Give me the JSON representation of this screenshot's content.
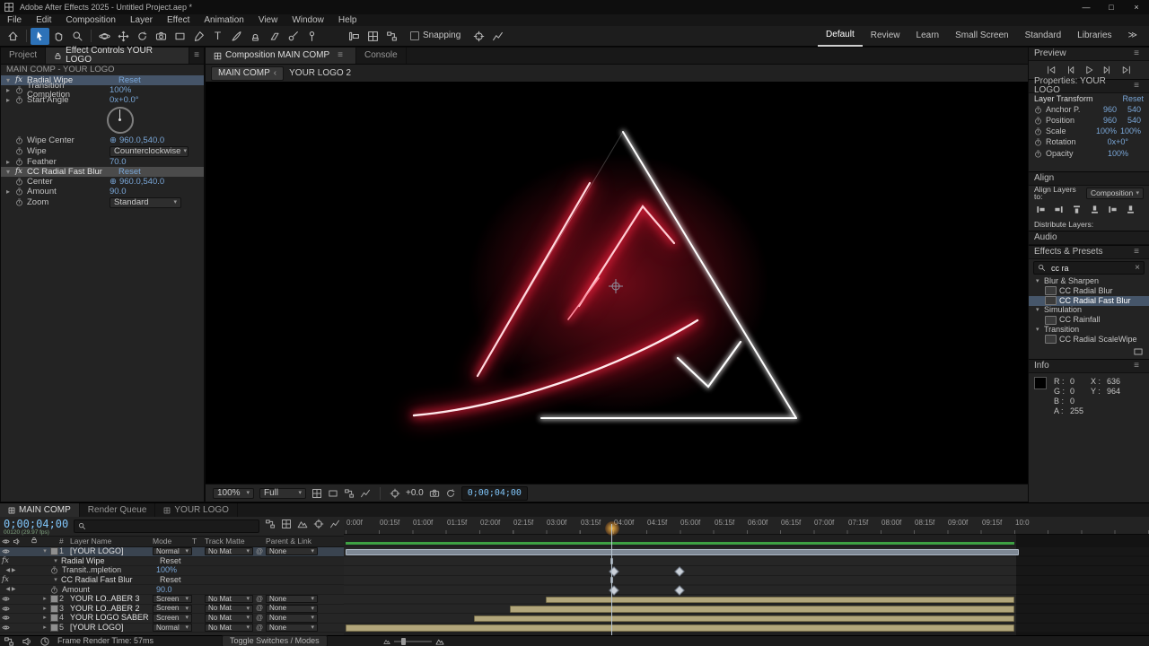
{
  "icons": {
    "minimize": "—",
    "maximize": "□",
    "close": "×",
    "menu": "≡",
    "chevron_down": "▾",
    "chevron_right": "▸",
    "overflow": "≫",
    "crosshair": "⊕",
    "pickwhip": "@",
    "back": "‹",
    "fx": "fx",
    "kf_prev": "◀",
    "kf_next": "▶",
    "clear": "×",
    "hash": "#"
  },
  "titlebar": {
    "title": "Adobe After Effects 2025 - Untitled Project.aep *"
  },
  "menubar": {
    "items": [
      "File",
      "Edit",
      "Composition",
      "Layer",
      "Effect",
      "Animation",
      "View",
      "Window",
      "Help"
    ]
  },
  "toolbar": {
    "snapping": "Snapping",
    "workspaces": [
      "Default",
      "Review",
      "Learn",
      "Small Screen",
      "Standard",
      "Libraries"
    ]
  },
  "effect_controls": {
    "tab_project": "Project",
    "tab_active": "Effect Controls YOUR LOGO",
    "comp": "MAIN COMP - YOUR LOGO",
    "groups": [
      {
        "name": "Radial Wipe",
        "reset": "Reset"
      },
      {
        "name": "CC Radial Fast Blur",
        "reset": "Reset"
      }
    ],
    "props": [
      {
        "label": "Transition Completion",
        "value": "100%"
      },
      {
        "label": "Start Angle",
        "value": "0x+0.0°"
      },
      {
        "label": "Wipe Center",
        "value": "960.0,540.0"
      },
      {
        "label": "Wipe",
        "value": "Counterclockwise"
      },
      {
        "label": "Feather",
        "value": "70.0"
      },
      {
        "label": "Center",
        "value": "960.0,540.0"
      },
      {
        "label": "Amount",
        "value": "90.0"
      },
      {
        "label": "Zoom",
        "value": "Standard"
      }
    ]
  },
  "viewer": {
    "tab_active": "Composition MAIN COMP",
    "tab_console": "Console",
    "breadcrumb_comp": "MAIN COMP",
    "breadcrumb_layer": "YOUR LOGO 2",
    "zoom": "100%",
    "resolution": "Full",
    "exposure": "+0.0",
    "timecode": "0;00;04;00"
  },
  "preview": {
    "title": "Preview"
  },
  "properties": {
    "title": "Properties: YOUR LOGO",
    "section": "Layer Transform",
    "reset": "Reset",
    "rows": [
      {
        "label": "Anchor P.",
        "v1": "960",
        "v2": "540"
      },
      {
        "label": "Position",
        "v1": "960",
        "v2": "540"
      },
      {
        "label": "Scale",
        "v1": "100%",
        "v2": "100%"
      },
      {
        "label": "Rotation",
        "v1": "0x+0°",
        "v2": ""
      },
      {
        "label": "Opacity",
        "v1": "100%",
        "v2": ""
      }
    ]
  },
  "align": {
    "title": "Align",
    "align_to_label": "Align Layers to:",
    "align_to": "Composition",
    "distribute_label": "Distribute Layers:"
  },
  "audio": {
    "title": "Audio"
  },
  "effects_presets": {
    "title": "Effects & Presets",
    "search": "cc ra",
    "tree": [
      {
        "label": "Blur & Sharpen",
        "group": true
      },
      {
        "label": "CC Radial Blur"
      },
      {
        "label": "CC Radial Fast Blur",
        "selected": true
      },
      {
        "label": "Simulation",
        "group": true
      },
      {
        "label": "CC Rainfall"
      },
      {
        "label": "Transition",
        "group": true
      },
      {
        "label": "CC Radial ScaleWipe"
      }
    ]
  },
  "info": {
    "title": "Info",
    "r_label": "R :",
    "r": "0",
    "g_label": "G :",
    "g": "0",
    "b_label": "B :",
    "b": "0",
    "a_label": "A :",
    "a": "255",
    "x_label": "X :",
    "x": "636",
    "y_label": "Y :",
    "y": "964"
  },
  "timeline": {
    "tabs": [
      "MAIN COMP",
      "Render Queue",
      "YOUR LOGO"
    ],
    "timecode": "0;00;04;00",
    "frame_info": "00120 (29.97 fps)",
    "columns": {
      "num": "#",
      "layer_name": "Layer Name",
      "mode": "Mode",
      "t": "T",
      "track_matte": "Track Matte",
      "parent": "Parent & Link"
    },
    "ruler": [
      "0:00f",
      "00:15f",
      "01:00f",
      "01:15f",
      "02:00f",
      "02:15f",
      "03:00f",
      "03:15f",
      "04:00f",
      "04:15f",
      "05:00f",
      "05:15f",
      "06:00f",
      "06:15f",
      "07:00f",
      "07:15f",
      "08:00f",
      "08:15f",
      "09:00f",
      "09:15f",
      "10:0"
    ],
    "layers": [
      {
        "num": "1",
        "name": "[YOUR LOGO]",
        "mode": "Normal",
        "matte": "No Mat",
        "parent": "None"
      },
      {
        "num": "2",
        "name": "YOUR LO..ABER 3",
        "mode": "Screen",
        "matte": "No Mat",
        "parent": "None"
      },
      {
        "num": "3",
        "name": "YOUR LO..ABER 2",
        "mode": "Screen",
        "matte": "No Mat",
        "parent": "None"
      },
      {
        "num": "4",
        "name": "YOUR LOGO SABER",
        "mode": "Screen",
        "matte": "No Mat",
        "parent": "None"
      },
      {
        "num": "5",
        "name": "[YOUR LOGO]",
        "mode": "Normal",
        "matte": "No Mat",
        "parent": "None"
      }
    ],
    "effect_rows": [
      {
        "label": "Radial Wipe",
        "value": "Reset"
      },
      {
        "label": "Transit..mpletion",
        "value": "100%"
      },
      {
        "label": "CC Radial Fast Blur",
        "value": "Reset"
      },
      {
        "label": "Amount",
        "value": "90.0"
      }
    ]
  },
  "statusbar": {
    "render_time": "Frame Render Time: 57ms",
    "toggle_label": "Toggle Switches / Modes"
  }
}
